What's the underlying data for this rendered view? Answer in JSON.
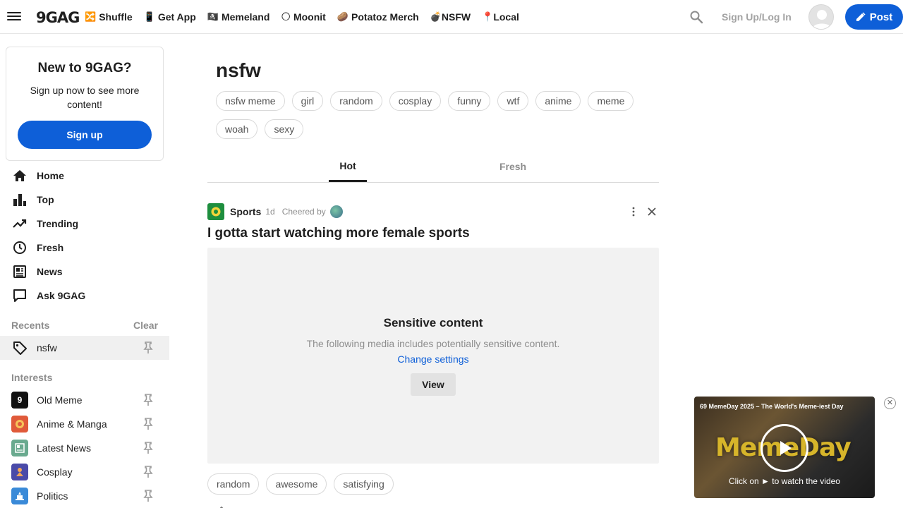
{
  "header": {
    "logo": "9GAG",
    "nav": [
      {
        "emoji": "🔀",
        "label": "Shuffle"
      },
      {
        "emoji": "📱",
        "label": "Get App"
      },
      {
        "emoji": "🏴‍☠️",
        "label": "Memeland"
      },
      {
        "emoji": "🌕",
        "label": "Moonit"
      },
      {
        "emoji": "🥔",
        "label": "Potatoz Merch"
      },
      {
        "emoji": "💣",
        "label": "NSFW"
      },
      {
        "emoji": "📍",
        "label": "Local"
      }
    ],
    "signup_login": "Sign Up/Log In",
    "post_label": "Post"
  },
  "sidebar": {
    "card": {
      "title": "New to 9GAG?",
      "text": "Sign up now to see more content!",
      "button": "Sign up"
    },
    "nav": [
      {
        "label": "Home",
        "icon": "home-icon"
      },
      {
        "label": "Top",
        "icon": "bar-chart-icon"
      },
      {
        "label": "Trending",
        "icon": "trending-icon"
      },
      {
        "label": "Fresh",
        "icon": "clock-icon"
      },
      {
        "label": "News",
        "icon": "newspaper-icon"
      },
      {
        "label": "Ask 9GAG",
        "icon": "chat-icon"
      }
    ],
    "recents_title": "Recents",
    "clear_label": "Clear",
    "recents": [
      {
        "label": "nsfw",
        "icon": "tag-icon"
      }
    ],
    "interests_title": "Interests",
    "interests": [
      {
        "label": "Old Meme",
        "color": "#111111"
      },
      {
        "label": "Anime & Manga",
        "color": "#e05a3a"
      },
      {
        "label": "Latest News",
        "color": "#6aaa8f"
      },
      {
        "label": "Cosplay",
        "color": "#4a4aa8"
      },
      {
        "label": "Politics",
        "color": "#3a8ad8"
      }
    ]
  },
  "main": {
    "title": "nsfw",
    "tags": [
      "nsfw meme",
      "girl",
      "random",
      "cosplay",
      "funny",
      "wtf",
      "anime",
      "meme",
      "woah",
      "sexy"
    ],
    "tabs": [
      {
        "label": "Hot",
        "active": true
      },
      {
        "label": "Fresh",
        "active": false
      }
    ],
    "post": {
      "section": "Sports",
      "age": "1d",
      "cheered_by": "Cheered by",
      "title": "I gotta start watching more female sports",
      "sensitive_title": "Sensitive content",
      "sensitive_desc": "The following media includes potentially sensitive content.",
      "change_settings": "Change settings",
      "view_label": "View",
      "tags": [
        "random",
        "awesome",
        "satisfying"
      ]
    }
  },
  "video_ad": {
    "title": "69 MemeDay 2025 – The World's Meme-iest Day",
    "brand": "MemeDay",
    "hint": "Click on ► to watch the video",
    "close": "✕"
  },
  "colors": {
    "accent": "#0e5fd8",
    "muted": "#8e8e8e"
  }
}
